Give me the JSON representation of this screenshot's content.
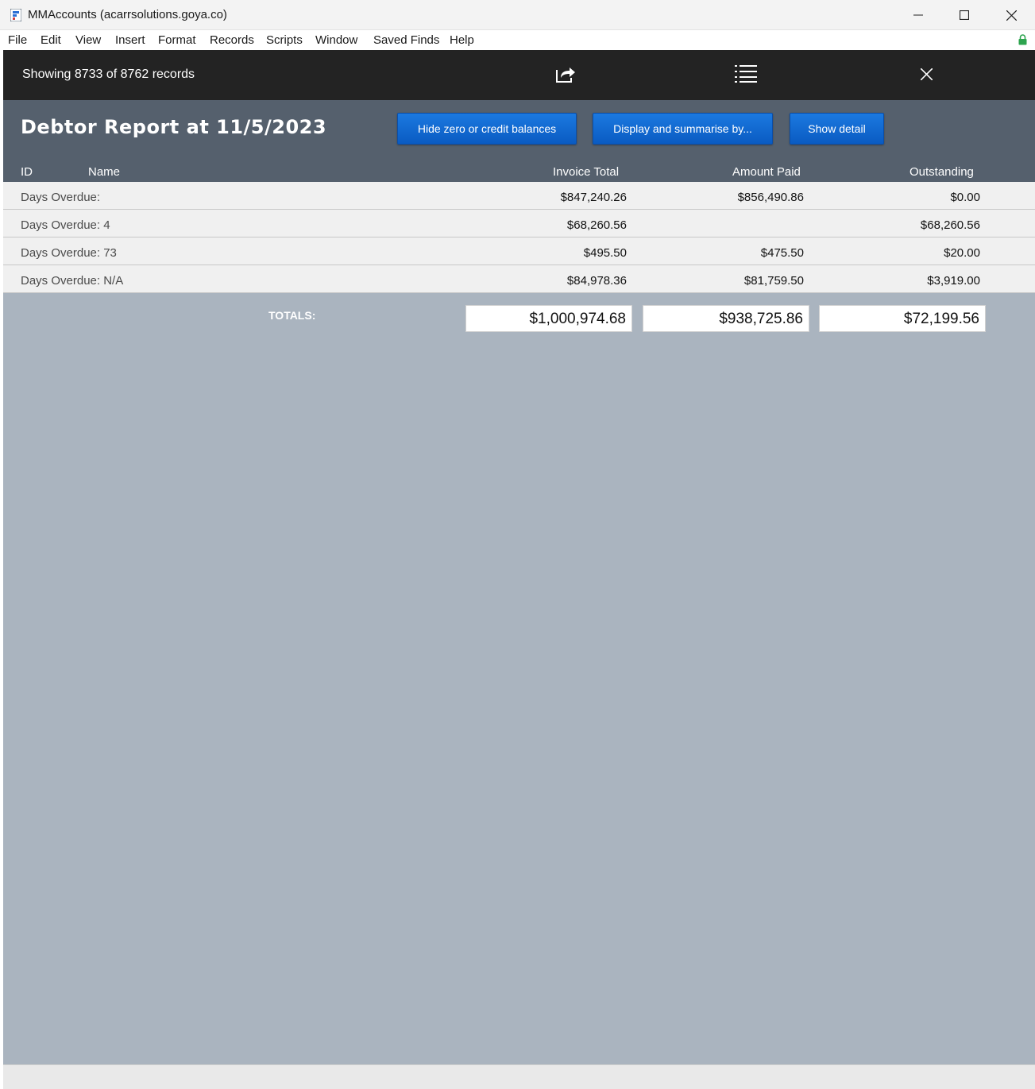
{
  "window": {
    "title": "MMAccounts (acarrsolutions.goya.co)"
  },
  "menu": [
    "File",
    "Edit",
    "View",
    "Insert",
    "Format",
    "Records",
    "Scripts",
    "Window",
    "Saved Finds",
    "Help"
  ],
  "toolbar": {
    "record_count": "Showing 8733 of 8762 records"
  },
  "report": {
    "title": "Debtor Report at 11/5/2023",
    "buttons": {
      "hide_zero": "Hide zero or credit balances",
      "display_summarise": "Display and summarise by...",
      "show_detail": "Show detail"
    },
    "columns": {
      "id": "ID",
      "name": "Name",
      "invoice_total": "Invoice Total",
      "amount_paid": "Amount Paid",
      "outstanding": "Outstanding"
    },
    "rows": [
      {
        "label": "Days Overdue:",
        "invoice_total": "$847,240.26",
        "amount_paid": "$856,490.86",
        "outstanding": "$0.00"
      },
      {
        "label": "Days Overdue: 4",
        "invoice_total": "$68,260.56",
        "amount_paid": "",
        "outstanding": "$68,260.56"
      },
      {
        "label": "Days Overdue: 73",
        "invoice_total": "$495.50",
        "amount_paid": "$475.50",
        "outstanding": "$20.00"
      },
      {
        "label": "Days Overdue: N/A",
        "invoice_total": "$84,978.36",
        "amount_paid": "$81,759.50",
        "outstanding": "$3,919.00"
      }
    ],
    "totals": {
      "label": "TOTALS:",
      "invoice_total": "$1,000,974.68",
      "amount_paid": "$938,725.86",
      "outstanding": "$72,199.56"
    }
  },
  "colors": {
    "toolbar_bg": "#232323",
    "header_bg": "#55606d",
    "body_bg": "#aab4bf",
    "button_blue": "#0a5bc2"
  }
}
